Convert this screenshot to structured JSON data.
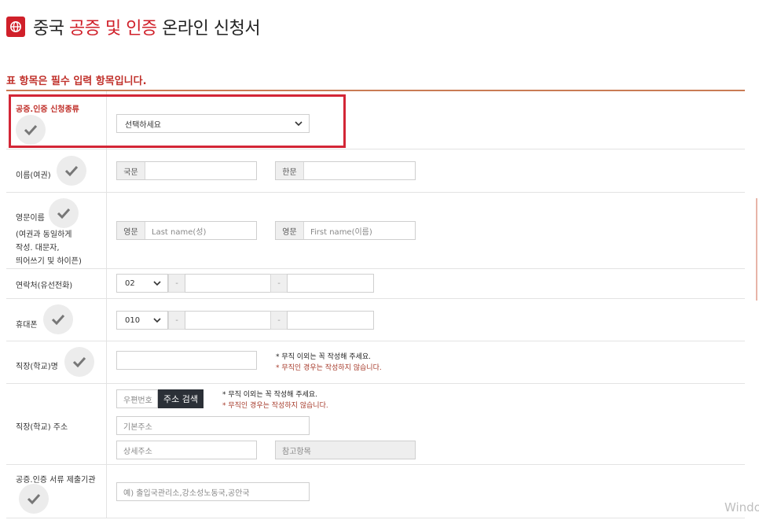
{
  "header": {
    "title_p1": "중국 ",
    "title_p2": "공증 및 인증",
    "title_p3": " 온라인 신청서",
    "globe_icon": "globe-icon",
    "accent_color": "#d0202a"
  },
  "required_note": "표 항목은 필수 입력 항목입니다.",
  "form": {
    "type_row": {
      "label": "공증.인증 신청종류",
      "select_value": "선택하세요"
    },
    "name_row": {
      "label": "이름(여권)",
      "korean_prefix": "국문",
      "hanja_prefix": "한문"
    },
    "eng_name_row": {
      "label": "영문이름",
      "sublabel_1": "(여권과 동일하게",
      "sublabel_2": "작성. 대문자,",
      "sublabel_3": "띄어쓰기 및 하이픈)",
      "prefix": "영문",
      "last_placeholder": "Last name(성)",
      "first_placeholder": "First name(이름)"
    },
    "phone_row": {
      "label": "연락처(유선전화)",
      "area_code": "02",
      "dash": "-"
    },
    "mobile_row": {
      "label": "휴대폰",
      "prefix_code": "010",
      "dash": "-"
    },
    "workplace_row": {
      "label": "직장(학교)명",
      "note_1": "* 무직 이외는 꼭 작성해 주세요.",
      "note_2": "* 무직인 경우는 작성하지 않습니다."
    },
    "address_row": {
      "label": "직장(학교) 주소",
      "zip_placeholder": "우편번호",
      "search_button": "주소 검색",
      "note_1": "* 무직 이외는 꼭 작성해 주세요.",
      "note_2": "* 무직인 경우는 작성하지 않습니다.",
      "base_placeholder": "기본주소",
      "detail_placeholder": "상세주소",
      "ref_placeholder": "참고항목"
    },
    "agency_row": {
      "label": "공증.인증 서류 제출기관",
      "placeholder": "예) 출입국관리소,강소성노동국,공안국"
    }
  },
  "watermark": "Windo"
}
